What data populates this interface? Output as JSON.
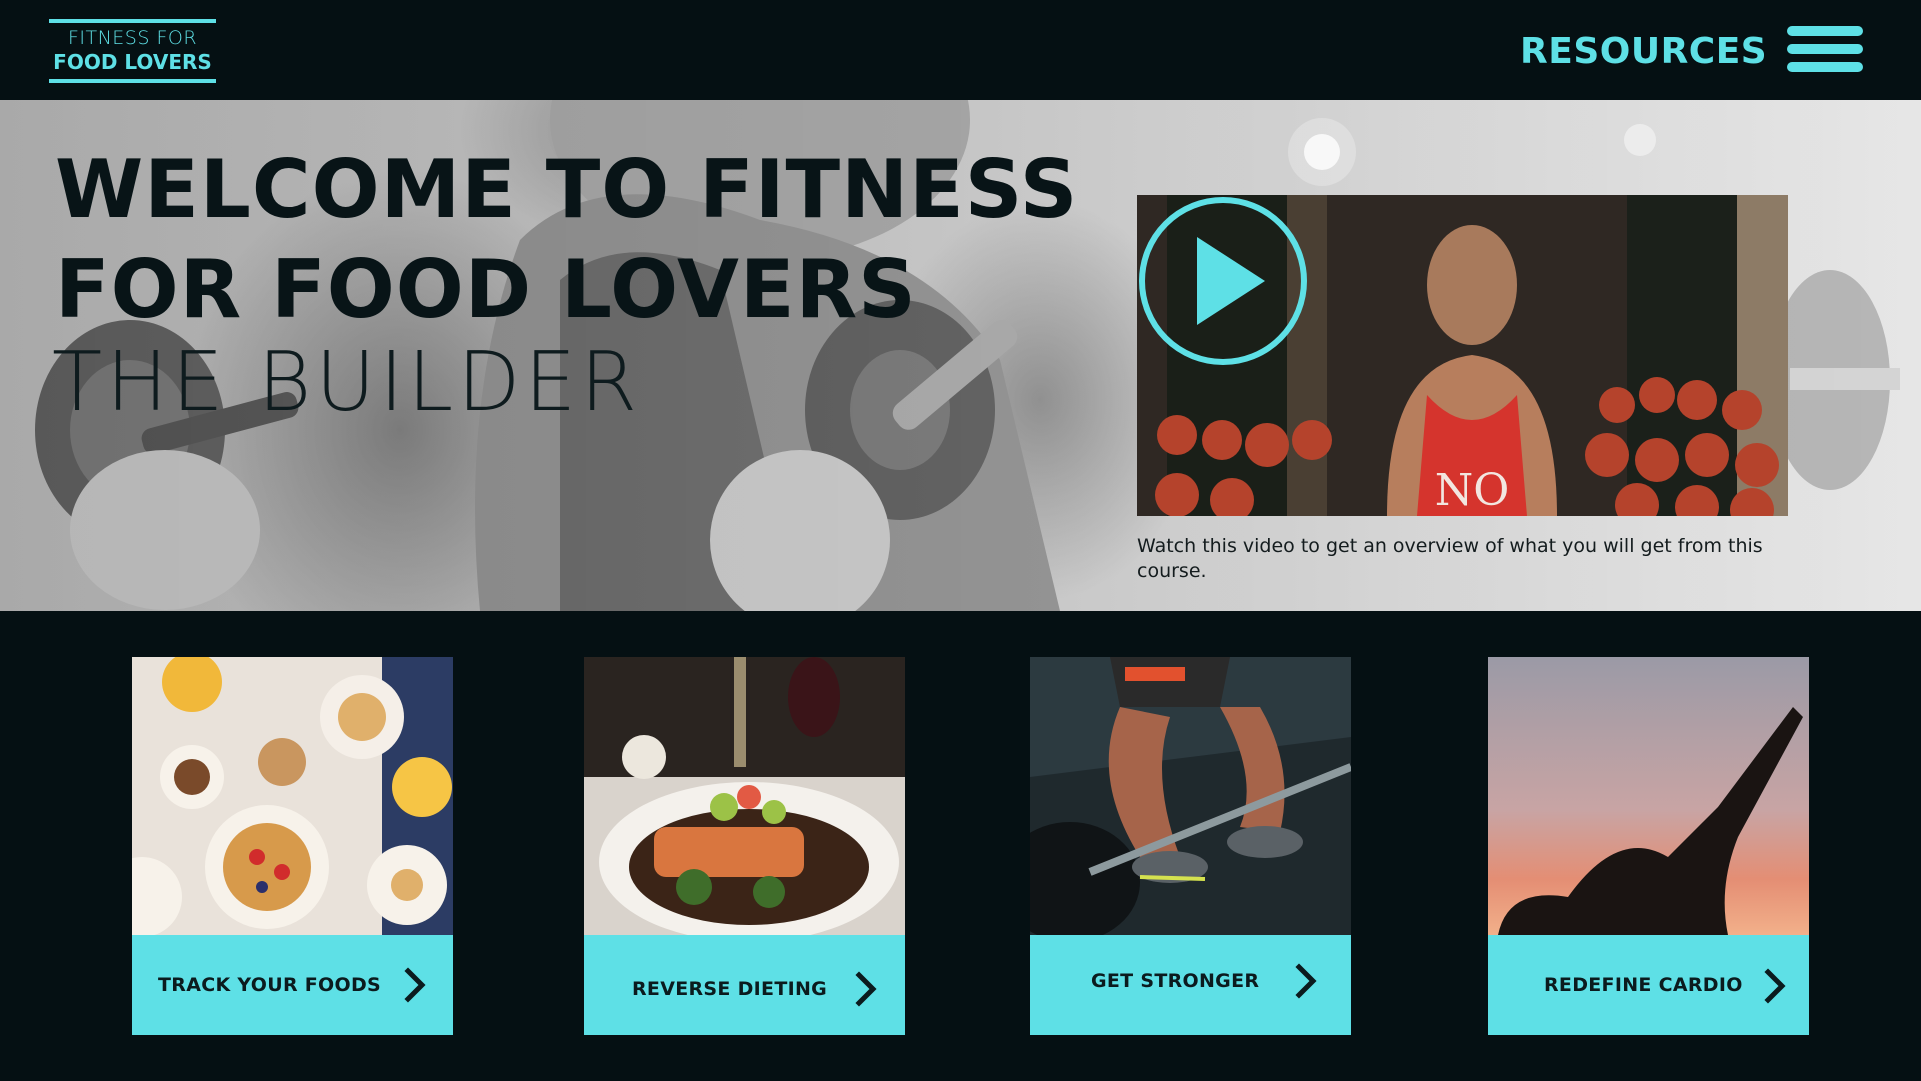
{
  "header": {
    "logo_line1": "FITNESS FOR",
    "logo_line2": "FOOD LOVERS",
    "resources_label": "RESOURCES",
    "menu_icon": "hamburger-menu-icon"
  },
  "hero": {
    "title_line1": "WELCOME TO FITNESS",
    "title_line2": "FOR FOOD LOVERS",
    "subtitle": "THE BUILDER",
    "video_caption": "Watch this video to get an overview of what you will get from this course.",
    "video_shirt_text": "NO",
    "play_icon": "play-icon"
  },
  "cards": [
    {
      "label": "TRACK YOUR FOODS",
      "icon": "chevron-right-icon",
      "image": "breakfast-table-photo"
    },
    {
      "label": "REVERSE DIETING",
      "icon": "chevron-right-icon",
      "image": "salmon-plate-photo"
    },
    {
      "label": "GET STRONGER",
      "icon": "chevron-right-icon",
      "image": "barbell-lift-photo"
    },
    {
      "label": "REDEFINE CARDIO",
      "icon": "chevron-right-icon",
      "image": "sunset-yoga-photo"
    }
  ],
  "colors": {
    "accent": "#5ee0e6",
    "dark": "#051013"
  }
}
